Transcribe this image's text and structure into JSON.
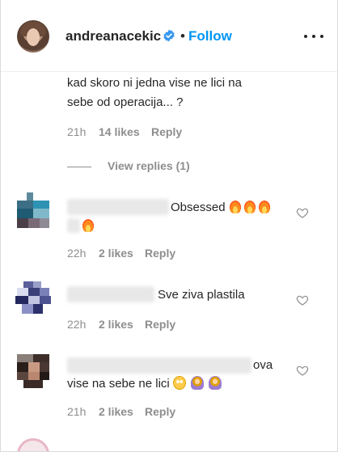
{
  "header": {
    "username": "andreanacekic",
    "separator": "•",
    "follow_label": "Follow",
    "verified_icon": "verified-badge-icon",
    "more_icon": "more-options-icon"
  },
  "comments": [
    {
      "text_line1": "kad skoro ni jedna vise ne lici na",
      "text_line2": "sebe od operacija... ?",
      "time": "21h",
      "likes": "14 likes",
      "reply": "Reply",
      "view_replies": "View replies (1)"
    },
    {
      "text_visible": "Obsessed",
      "time": "22h",
      "likes": "2 likes",
      "reply": "Reply"
    },
    {
      "text_visible": "Sve ziva plastila",
      "time": "22h",
      "likes": "2 likes",
      "reply": "Reply"
    },
    {
      "text_visible_line1": "ova",
      "text_line2": "vise na sebe ne lici",
      "time": "21h",
      "likes": "2 likes",
      "reply": "Reply"
    }
  ],
  "colors": {
    "accent": "#0095f6",
    "text": "#262626",
    "secondary": "#8e8e8e"
  }
}
